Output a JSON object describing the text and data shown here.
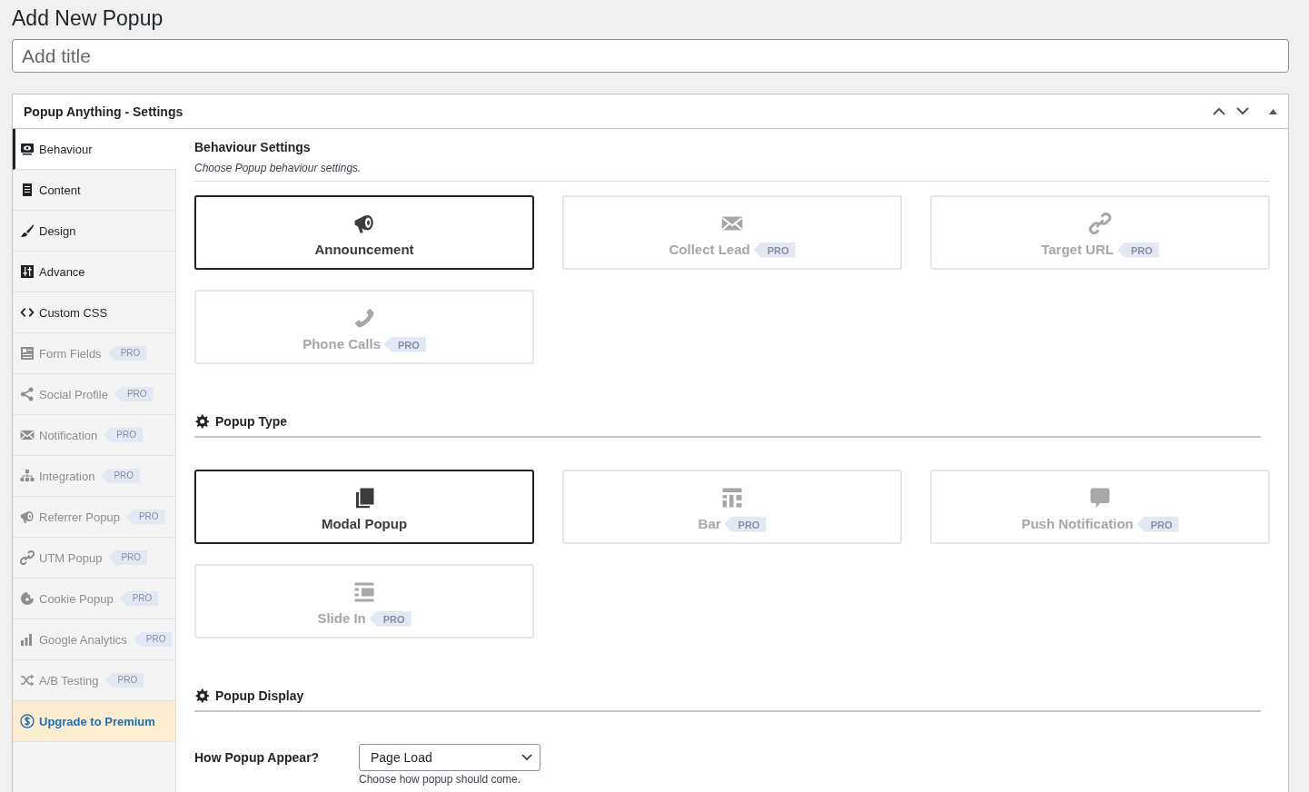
{
  "page_title": "Add New Popup",
  "title_field": {
    "placeholder": "Add title"
  },
  "panel": {
    "title": "Popup Anything - Settings"
  },
  "sidebar": [
    {
      "kind": "tab",
      "label": "Behaviour",
      "selected": true,
      "disabled": false
    },
    {
      "kind": "tab",
      "label": "Content",
      "selected": false,
      "disabled": false
    },
    {
      "kind": "tab",
      "label": "Design",
      "selected": false,
      "disabled": false
    },
    {
      "kind": "tab",
      "label": "Advance",
      "selected": false,
      "disabled": false
    },
    {
      "kind": "tab",
      "label": "Custom CSS",
      "selected": false,
      "disabled": false
    },
    {
      "kind": "tab",
      "label": "Form Fields",
      "selected": false,
      "disabled": true,
      "badge": "PRO"
    },
    {
      "kind": "tab",
      "label": "Social Profile",
      "selected": false,
      "disabled": true,
      "badge": "PRO"
    },
    {
      "kind": "tab",
      "label": "Notification",
      "selected": false,
      "disabled": true,
      "badge": "PRO"
    },
    {
      "kind": "tab",
      "label": "Integration",
      "selected": false,
      "disabled": true,
      "badge": "PRO"
    },
    {
      "kind": "tab",
      "label": "Referrer Popup",
      "selected": false,
      "disabled": true,
      "badge": "PRO"
    },
    {
      "kind": "tab",
      "label": "UTM Popup",
      "selected": false,
      "disabled": true,
      "badge": "PRO"
    },
    {
      "kind": "tab",
      "label": "Cookie Popup",
      "selected": false,
      "disabled": true,
      "badge": "PRO"
    },
    {
      "kind": "tab",
      "label": "Google Analytics",
      "selected": false,
      "disabled": true,
      "badge": "PRO"
    },
    {
      "kind": "tab",
      "label": "A/B Testing",
      "selected": false,
      "disabled": true,
      "badge": "PRO"
    },
    {
      "kind": "upgrade",
      "label": "Upgrade to Premium",
      "selected": false,
      "disabled": false
    }
  ],
  "behaviour": {
    "title": "Behaviour Settings",
    "description": "Choose Popup behaviour settings.",
    "options": [
      {
        "label": "Announcement",
        "selected": true,
        "disabled": false
      },
      {
        "label": "Collect Lead",
        "selected": false,
        "disabled": true,
        "badge": "PRO"
      },
      {
        "label": "Target URL",
        "selected": false,
        "disabled": true,
        "badge": "PRO"
      },
      {
        "label": "Phone Calls",
        "selected": false,
        "disabled": true,
        "badge": "PRO"
      }
    ]
  },
  "popup_type": {
    "title": "Popup Type",
    "options": [
      {
        "label": "Modal Popup",
        "selected": true,
        "disabled": false
      },
      {
        "label": "Bar",
        "selected": false,
        "disabled": true,
        "badge": "PRO"
      },
      {
        "label": "Push Notification",
        "selected": false,
        "disabled": true,
        "badge": "PRO"
      },
      {
        "label": "Slide In",
        "selected": false,
        "disabled": true,
        "badge": "PRO"
      }
    ]
  },
  "popup_display": {
    "title": "Popup Display",
    "fields": [
      {
        "label": "How Popup Appear?",
        "value": "Page Load",
        "help": "Choose how popup should come."
      }
    ]
  }
}
